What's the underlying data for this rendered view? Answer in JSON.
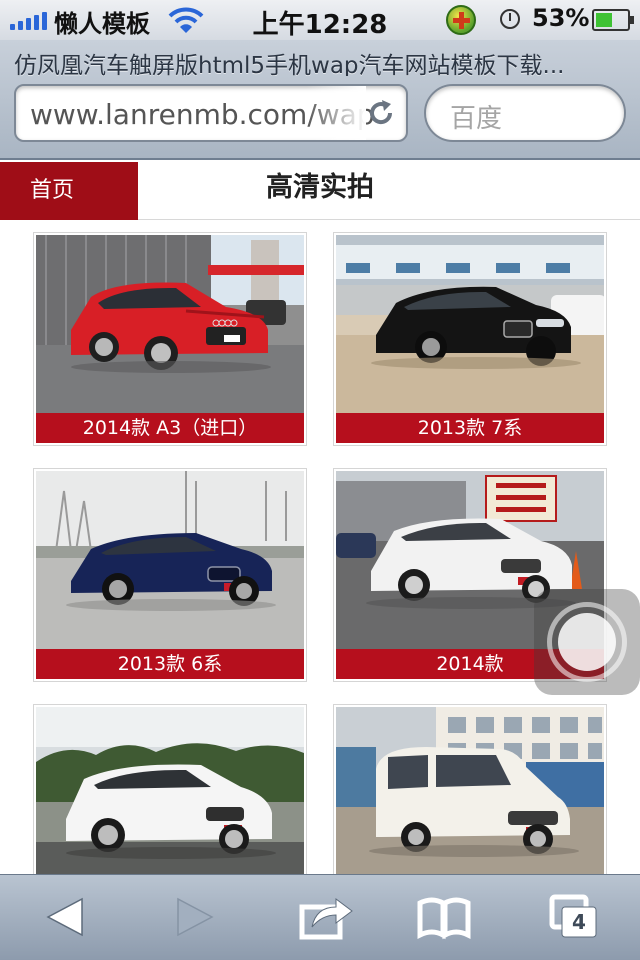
{
  "status_bar": {
    "carrier": "懒人模板",
    "time": "上午12:28",
    "battery_percent": "53%",
    "battery_level": 0.53,
    "icons": [
      "signal-bars-icon",
      "wifi-icon",
      "plus-badge-icon",
      "alarm-clock-icon",
      "battery-icon"
    ]
  },
  "browser": {
    "page_title": "仿凤凰汽车触屏版html5手机wap汽车网站模板下载...",
    "url": "www.lanrenmb.com/wap",
    "search_placeholder": "百度",
    "icons": [
      "reload-icon"
    ]
  },
  "site": {
    "home_tab": "首页",
    "title": "高清实拍"
  },
  "gallery": [
    {
      "caption": "2014款 A3（进口）",
      "car_color": "#d81f26",
      "scene": "red-hatchback"
    },
    {
      "caption": "2013款 7系",
      "car_color": "#111111",
      "scene": "black-sedan"
    },
    {
      "caption": "2013款 6系",
      "car_color": "#172457",
      "scene": "blue-coupe"
    },
    {
      "caption": "2014款",
      "car_color": "#f2f2f2",
      "scene": "white-sedan"
    },
    {
      "caption": "",
      "car_color": "#f5f5f5",
      "scene": "white-suv"
    },
    {
      "caption": "",
      "car_color": "#f3f1ea",
      "scene": "white-van"
    }
  ],
  "toolbar": {
    "tabs_count": "4",
    "icons": [
      "back-icon",
      "forward-icon",
      "share-icon",
      "bookmarks-icon",
      "tabs-icon"
    ]
  },
  "colors": {
    "brand_red": "#9f0d17",
    "caption_red": "#b60f1d",
    "chrome_blue": "#a9b5c3"
  }
}
